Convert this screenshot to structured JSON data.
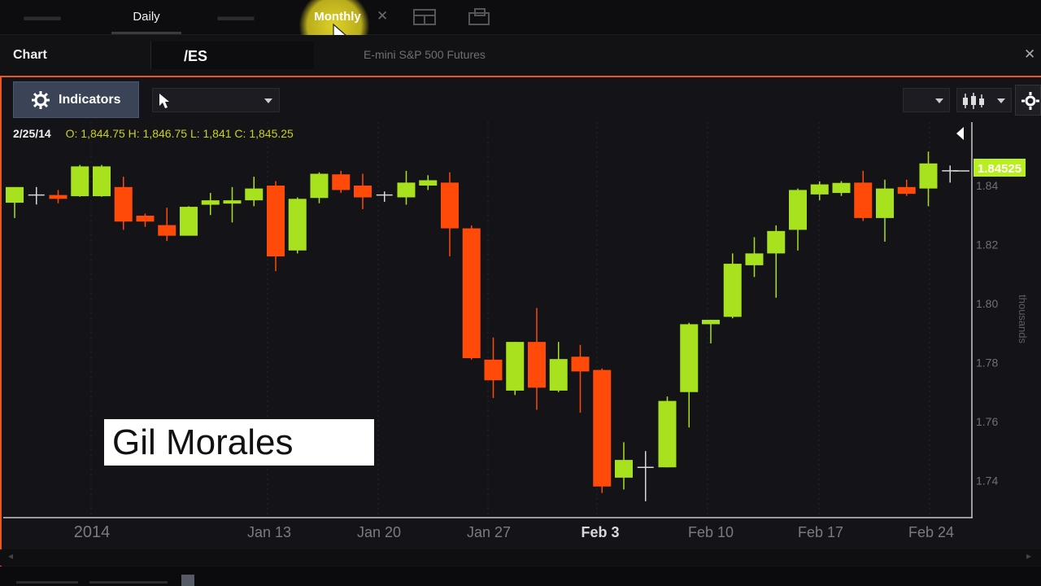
{
  "tabs": {
    "daily": "Daily",
    "monthly": "Monthly"
  },
  "header": {
    "title": "Chart",
    "symbol": "/ES",
    "description": "E-mini S&P 500 Futures"
  },
  "toolbar": {
    "indicators_label": "Indicators"
  },
  "ohlc": {
    "date": "2/25/14",
    "values": "O: 1,844.75 H: 1,846.75 L: 1,841 C: 1,845.25"
  },
  "watermark": "Gil Morales",
  "colors": {
    "up": "#a8e11e",
    "down": "#ff4a0a",
    "accent": "#e8581f",
    "price_tag": "#b9ef1e"
  },
  "chart_data": {
    "type": "candlestick",
    "price_label": "1.84525",
    "y_axis_unit": "thousands",
    "y_ticks": [
      "1.84",
      "1.82",
      "1.80",
      "1.78",
      "1.76",
      "1.74"
    ],
    "x_labels": [
      "2014",
      "Jan 13",
      "Jan 20",
      "Jan 27",
      "Feb 3",
      "Feb 10",
      "Feb 17",
      "Feb 24"
    ],
    "candles": [
      {
        "o": 1.8342,
        "h": 1.839,
        "l": 1.829,
        "c": 1.8395,
        "d": "up"
      },
      {
        "o": 1.8365,
        "h": 1.8395,
        "l": 1.8336,
        "c": 1.8368,
        "d": "flat"
      },
      {
        "o": 1.8368,
        "h": 1.8385,
        "l": 1.834,
        "c": 1.8355,
        "d": "down"
      },
      {
        "o": 1.8364,
        "h": 1.847,
        "l": 1.8362,
        "c": 1.8465,
        "d": "up"
      },
      {
        "o": 1.8364,
        "h": 1.847,
        "l": 1.8362,
        "c": 1.8465,
        "d": "up"
      },
      {
        "o": 1.8395,
        "h": 1.843,
        "l": 1.825,
        "c": 1.8278,
        "d": "down"
      },
      {
        "o": 1.8298,
        "h": 1.8305,
        "l": 1.826,
        "c": 1.8278,
        "d": "down"
      },
      {
        "o": 1.8266,
        "h": 1.8325,
        "l": 1.8212,
        "c": 1.823,
        "d": "down"
      },
      {
        "o": 1.823,
        "h": 1.833,
        "l": 1.823,
        "c": 1.8328,
        "d": "up"
      },
      {
        "o": 1.8335,
        "h": 1.8375,
        "l": 1.83,
        "c": 1.835,
        "d": "up"
      },
      {
        "o": 1.8345,
        "h": 1.8395,
        "l": 1.8275,
        "c": 1.835,
        "d": "up"
      },
      {
        "o": 1.835,
        "h": 1.843,
        "l": 1.833,
        "c": 1.839,
        "d": "up"
      },
      {
        "o": 1.84,
        "h": 1.8415,
        "l": 1.811,
        "c": 1.816,
        "d": "down"
      },
      {
        "o": 1.818,
        "h": 1.836,
        "l": 1.817,
        "c": 1.8355,
        "d": "up"
      },
      {
        "o": 1.8358,
        "h": 1.8445,
        "l": 1.834,
        "c": 1.844,
        "d": "up"
      },
      {
        "o": 1.8438,
        "h": 1.845,
        "l": 1.8375,
        "c": 1.8385,
        "d": "down"
      },
      {
        "o": 1.84,
        "h": 1.844,
        "l": 1.832,
        "c": 1.836,
        "d": "down"
      },
      {
        "o": 1.8365,
        "h": 1.838,
        "l": 1.8345,
        "c": 1.8368,
        "d": "flat"
      },
      {
        "o": 1.836,
        "h": 1.845,
        "l": 1.8335,
        "c": 1.841,
        "d": "up"
      },
      {
        "o": 1.84,
        "h": 1.8435,
        "l": 1.8385,
        "c": 1.8418,
        "d": "up"
      },
      {
        "o": 1.841,
        "h": 1.8445,
        "l": 1.816,
        "c": 1.8255,
        "d": "down"
      },
      {
        "o": 1.8255,
        "h": 1.8265,
        "l": 1.781,
        "c": 1.7815,
        "d": "down"
      },
      {
        "o": 1.781,
        "h": 1.7885,
        "l": 1.768,
        "c": 1.774,
        "d": "down"
      },
      {
        "o": 1.7705,
        "h": 1.787,
        "l": 1.769,
        "c": 1.787,
        "d": "up"
      },
      {
        "o": 1.787,
        "h": 1.7985,
        "l": 1.764,
        "c": 1.7715,
        "d": "down"
      },
      {
        "o": 1.7705,
        "h": 1.787,
        "l": 1.77,
        "c": 1.7812,
        "d": "up"
      },
      {
        "o": 1.782,
        "h": 1.786,
        "l": 1.763,
        "c": 1.777,
        "d": "down"
      },
      {
        "o": 1.7775,
        "h": 1.778,
        "l": 1.7358,
        "c": 1.738,
        "d": "down"
      },
      {
        "o": 1.741,
        "h": 1.753,
        "l": 1.737,
        "c": 1.747,
        "d": "up"
      },
      {
        "o": 1.7445,
        "h": 1.75,
        "l": 1.733,
        "c": 1.744,
        "d": "flat"
      },
      {
        "o": 1.7445,
        "h": 1.7685,
        "l": 1.7445,
        "c": 1.767,
        "d": "up"
      },
      {
        "o": 1.77,
        "h": 1.7935,
        "l": 1.758,
        "c": 1.793,
        "d": "up"
      },
      {
        "o": 1.793,
        "h": 1.7945,
        "l": 1.7865,
        "c": 1.7945,
        "d": "up"
      },
      {
        "o": 1.7955,
        "h": 1.817,
        "l": 1.795,
        "c": 1.8135,
        "d": "up"
      },
      {
        "o": 1.813,
        "h": 1.8225,
        "l": 1.809,
        "c": 1.817,
        "d": "up"
      },
      {
        "o": 1.817,
        "h": 1.8265,
        "l": 1.802,
        "c": 1.8246,
        "d": "up"
      },
      {
        "o": 1.825,
        "h": 1.839,
        "l": 1.818,
        "c": 1.8385,
        "d": "up"
      },
      {
        "o": 1.837,
        "h": 1.8414,
        "l": 1.835,
        "c": 1.8404,
        "d": "up"
      },
      {
        "o": 1.8375,
        "h": 1.8415,
        "l": 1.8365,
        "c": 1.8409,
        "d": "up"
      },
      {
        "o": 1.841,
        "h": 1.845,
        "l": 1.828,
        "c": 1.829,
        "d": "down"
      },
      {
        "o": 1.829,
        "h": 1.842,
        "l": 1.821,
        "c": 1.839,
        "d": "up"
      },
      {
        "o": 1.8395,
        "h": 1.842,
        "l": 1.8365,
        "c": 1.8372,
        "d": "down"
      },
      {
        "o": 1.839,
        "h": 1.8515,
        "l": 1.833,
        "c": 1.8475,
        "d": "up"
      },
      {
        "o": 1.845,
        "h": 1.8468,
        "l": 1.841,
        "c": 1.845,
        "d": "flat"
      }
    ]
  }
}
